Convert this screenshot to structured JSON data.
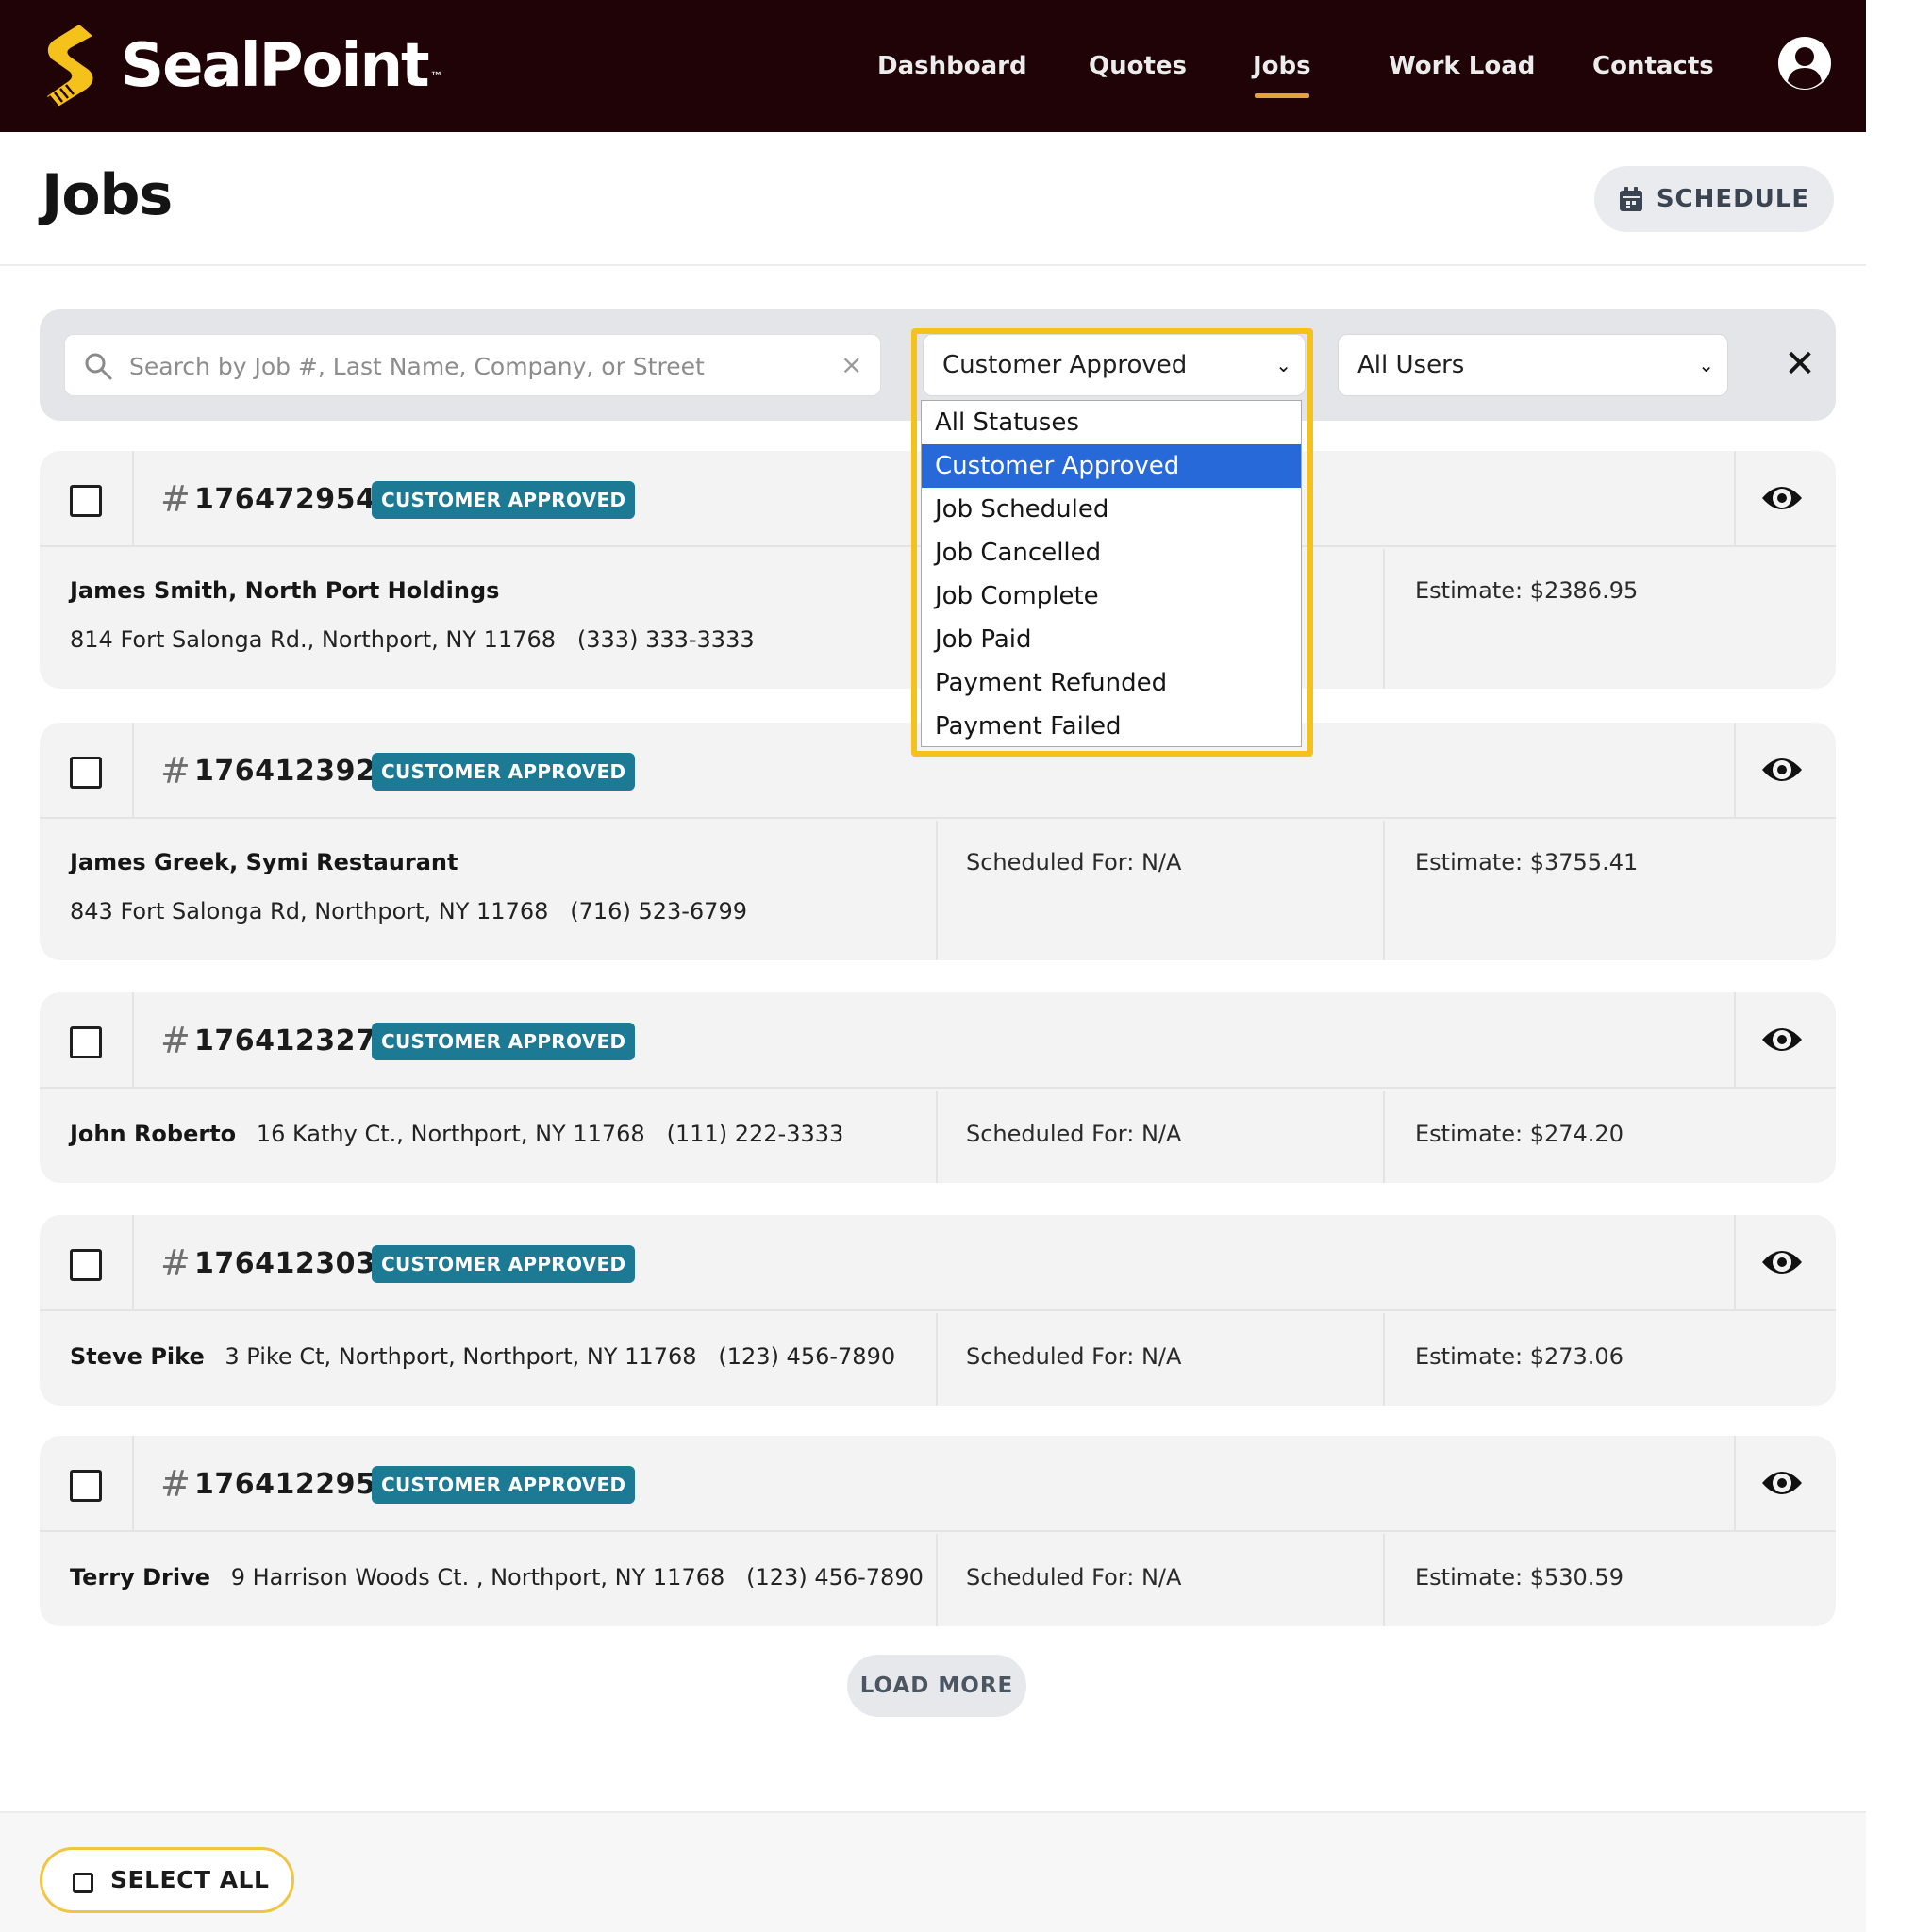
{
  "brand": {
    "name": "SealPoint",
    "trademark": "™",
    "accent_color": "#f5c21b",
    "nav_bg": "#1f0306"
  },
  "nav": {
    "items": [
      {
        "label": "Dashboard"
      },
      {
        "label": "Quotes"
      },
      {
        "label": "Jobs",
        "active": true
      },
      {
        "label": "Work Load"
      },
      {
        "label": "Contacts"
      }
    ],
    "account_icon": "user-circle-icon"
  },
  "page": {
    "title": "Jobs",
    "schedule_label": "SCHEDULE",
    "schedule_icon": "calendar-icon"
  },
  "filters": {
    "search_placeholder": "Search by Job #, Last Name, Company, or Street",
    "search_value": "",
    "search_icon": "search-icon",
    "clear_symbol": "×",
    "status_selected": "Customer Approved",
    "users_selected": "All Users",
    "close_symbol": "✕",
    "status_options": [
      "All Statuses",
      "Customer Approved",
      "Job Scheduled",
      "Job Cancelled",
      "Job Complete",
      "Job Paid",
      "Payment Refunded",
      "Payment Failed"
    ],
    "selected_option_color": "#2869d9"
  },
  "jobs": [
    {
      "number": "1764729541",
      "status": "CUSTOMER APPROVED",
      "customer": "James Smith, North Port Holdings",
      "address": "814 Fort Salonga Rd., Northport, NY 11768",
      "phone": "(333) 333-3333",
      "scheduled": "",
      "estimate": "Estimate: $2386.95"
    },
    {
      "number": "1764123920",
      "status": "CUSTOMER APPROVED",
      "customer": "James Greek, Symi Restaurant",
      "address": "843 Fort Salonga Rd, Northport, NY 11768",
      "phone": "(716) 523-6799",
      "scheduled": "Scheduled For: N/A",
      "estimate": "Estimate: $3755.41"
    },
    {
      "number": "1764123272",
      "status": "CUSTOMER APPROVED",
      "customer": "John Roberto",
      "address": "16 Kathy Ct., Northport, NY 11768",
      "phone": "(111) 222-3333",
      "scheduled": "Scheduled For: N/A",
      "estimate": "Estimate: $274.20"
    },
    {
      "number": "1764123030",
      "status": "CUSTOMER APPROVED",
      "customer": "Steve Pike",
      "address": "3 Pike Ct, Northport, Northport, NY 11768",
      "phone": "(123) 456-7890",
      "scheduled": "Scheduled For: N/A",
      "estimate": "Estimate: $273.06"
    },
    {
      "number": "1764122955",
      "status": "CUSTOMER APPROVED",
      "customer": "Terry Drive",
      "address": "9 Harrison Woods Ct. , Northport, NY 11768",
      "phone": "(123) 456-7890",
      "scheduled": "Scheduled For: N/A",
      "estimate": "Estimate: $530.59"
    }
  ],
  "badge_color": "#1c7a94",
  "load_more_label": "LOAD MORE",
  "select_all_label": "SELECT ALL"
}
